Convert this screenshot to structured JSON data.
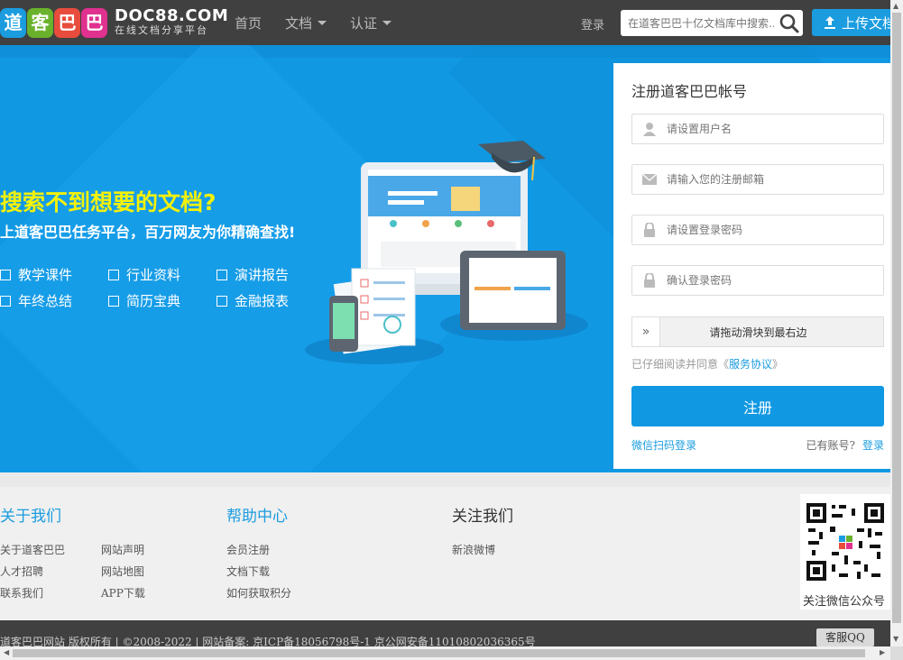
{
  "header": {
    "logo_chars": [
      "道",
      "客",
      "巴",
      "巴"
    ],
    "logo_colors": [
      "#1a9cdf",
      "#6ab22c",
      "#e74c3c",
      "#e0318f"
    ],
    "logo_domain": "DOC88.COM",
    "logo_tagline": "在线文档分享平台",
    "nav": [
      {
        "label": "首页",
        "dropdown": false
      },
      {
        "label": "文档",
        "dropdown": true
      },
      {
        "label": "认证",
        "dropdown": true
      }
    ],
    "login_label": "登录",
    "search_placeholder": "在道客巴巴十亿文档库中搜索...",
    "upload_label": "上传文档"
  },
  "banner": {
    "title": "搜索不到想要的文档?",
    "subtitle": "上道客巴巴任务平台，百万网友为你精确查找!",
    "categories": [
      "教学课件",
      "行业资料",
      "演讲报告",
      "年终总结",
      "简历宝典",
      "金融报表"
    ]
  },
  "register": {
    "title": "注册道客巴巴帐号",
    "username_placeholder": "请设置用户名",
    "email_placeholder": "请输入您的注册邮箱",
    "password_placeholder": "请设置登录密码",
    "confirm_placeholder": "确认登录密码",
    "slider_text": "请拖动滑块到最右边",
    "agree_text": "已仔细阅读并同意《",
    "agree_link": "服务协议",
    "agree_end": "》",
    "submit_label": "注册",
    "wechat_login": "微信扫码登录",
    "have_account": "已有账号?",
    "login_link": "登录"
  },
  "footer": {
    "about_title": "关于我们",
    "about_links": [
      "关于道客巴巴",
      "人才招聘",
      "联系我们"
    ],
    "about_links2": [
      "网站声明",
      "网站地图",
      "APP下载"
    ],
    "help_title": "帮助中心",
    "help_links": [
      "会员注册",
      "文档下载",
      "如何获取积分"
    ],
    "follow_title": "关注我们",
    "follow_links": [
      "新浪微博"
    ],
    "qr_caption": "关注微信公众号",
    "copyright": "道客巴巴网站 版权所有  | ©2008-2022  |  网站备案:  京ICP备18056798号-1  京公网安备11010802036365号",
    "service_label": "客服QQ"
  }
}
